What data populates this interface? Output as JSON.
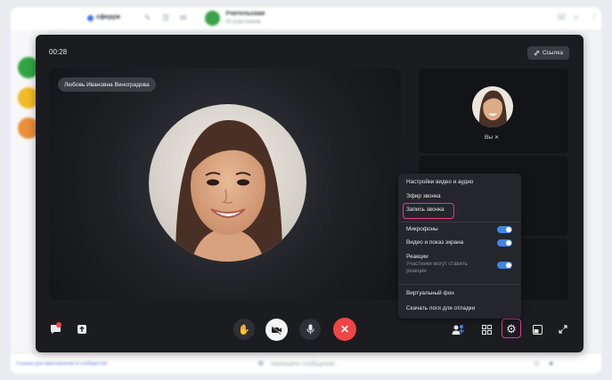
{
  "app": {
    "brand": "сферум",
    "chat_title": "Учительская",
    "chat_subtitle": "20 участников",
    "bottom_link": "Ссылка для приглашения в сообщество",
    "message_placeholder": "Напишите сообщение..."
  },
  "call": {
    "timer": "00:28",
    "link_label": "Ссылка",
    "main_participant": "Любовь Ивановна Виноградова",
    "side_participant": "Вы"
  },
  "menu": {
    "items": [
      {
        "label": "Настройки видео и аудио"
      },
      {
        "label": "Эфир звонка"
      },
      {
        "label": "Запись звонка"
      }
    ],
    "toggles": [
      {
        "label": "Микрофоны",
        "on": true
      },
      {
        "label": "Видео и показ экрана",
        "on": true
      },
      {
        "label": "Реакции",
        "sub": "Участники могут ставить реакции",
        "on": true
      }
    ],
    "extra": [
      {
        "label": "Виртуальный фон"
      },
      {
        "label": "Скачать логи для отладки"
      }
    ]
  },
  "colors": {
    "accent": "#3f86ea",
    "hangup": "#ef4545",
    "highlight": "#e23c8c"
  }
}
